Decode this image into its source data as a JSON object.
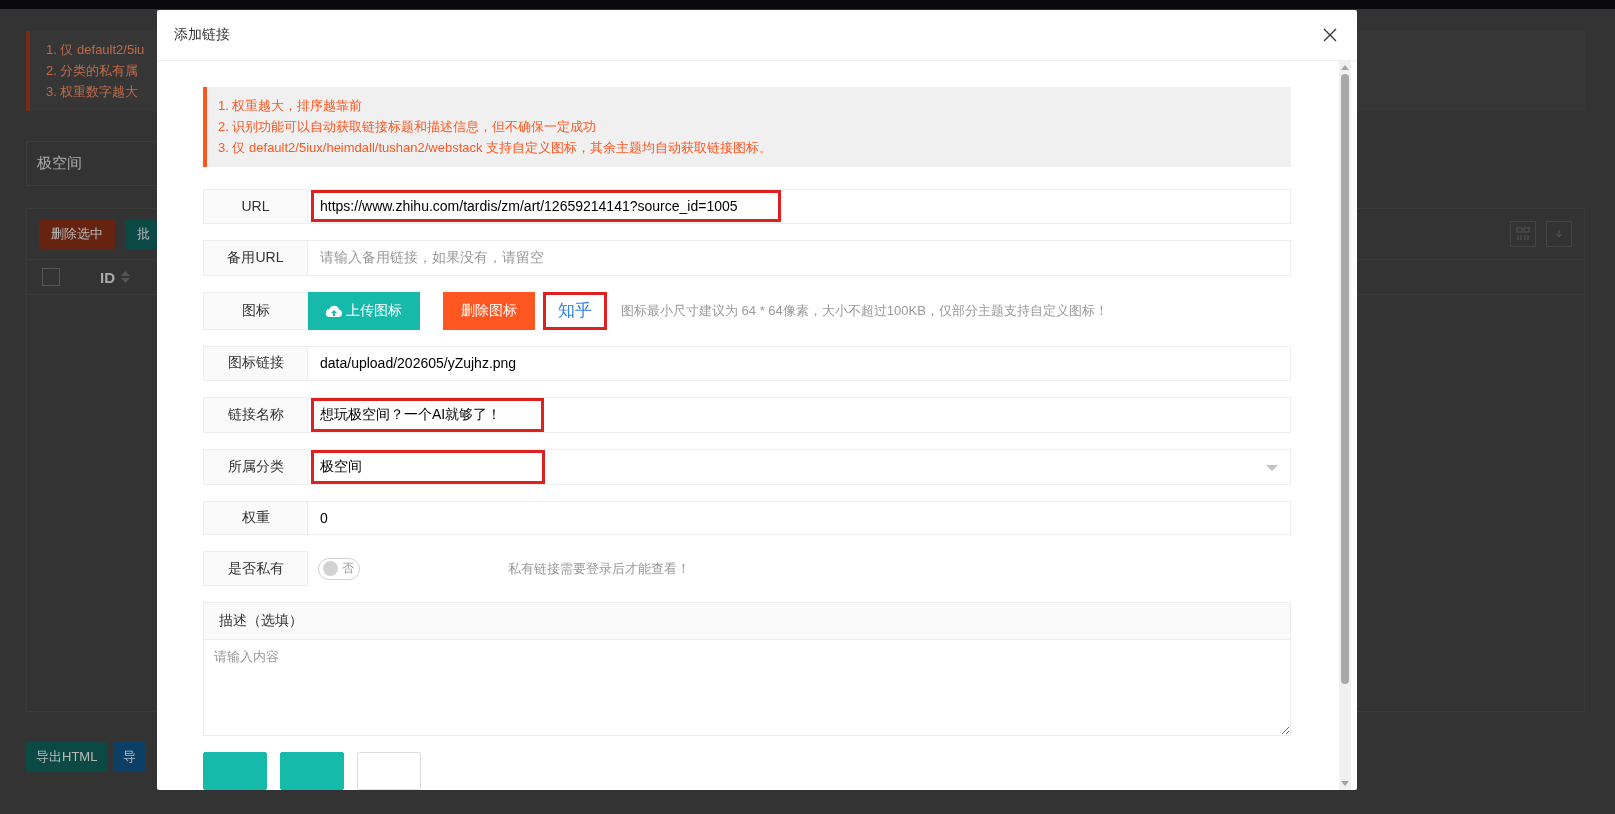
{
  "page": {
    "notices": [
      "1. 仅 default2/5iu",
      "2. 分类的私有属",
      "3. 权重数字越大"
    ],
    "category_filter": "极空间",
    "toolbar_buttons": [
      {
        "label": "删除选中",
        "kind": "danger"
      },
      {
        "label": "批",
        "kind": "primary"
      }
    ],
    "table": {
      "select_all_checked": false,
      "columns": [
        "ID"
      ]
    },
    "footer_buttons": [
      {
        "label": "导出HTML",
        "kind": "primary"
      },
      {
        "label": "导",
        "kind": "info"
      }
    ]
  },
  "dialog": {
    "title": "添加链接",
    "notices": [
      "1. 权重越大，排序越靠前",
      "2. 识别功能可以自动获取链接标题和描述信息，但不确保一定成功",
      "3. 仅 default2/5iux/heimdall/tushan2/webstack 支持自定义图标，其余主题均自动获取链接图标。"
    ],
    "fields": [
      {
        "kind": "text",
        "label": "URL",
        "value": "https://www.zhihu.com/tardis/zm/art/12659214141?source_id=1005",
        "highlighted": true
      },
      {
        "kind": "text",
        "label": "备用URL",
        "placeholder": "请输入备用链接，如果没有，请留空",
        "highlighted": false
      },
      {
        "kind": "icon",
        "label": "图标",
        "buttons": [
          {
            "label": "上传图标",
            "kind": "primary"
          },
          {
            "label": "删除图标",
            "kind": "danger"
          }
        ],
        "preview": "知乎",
        "highlighted": true,
        "hint": "图标最小尺寸建议为 64 * 64像素，大小不超过100KB，仅部分主题支持自定义图标！"
      },
      {
        "kind": "text",
        "label": "图标链接",
        "value": "data/upload/202605/yZujhz.png",
        "highlighted": false
      },
      {
        "kind": "text",
        "label": "链接名称",
        "value": "想玩极空间？一个AI就够了！",
        "highlighted": true
      },
      {
        "kind": "select",
        "label": "所属分类",
        "value": "极空间",
        "highlighted": true
      },
      {
        "kind": "text",
        "label": "权重",
        "value": "0",
        "highlighted": false
      },
      {
        "kind": "switch",
        "label": "是否私有",
        "on": false,
        "switch_text": "否",
        "hint": "私有链接需要登录后才能查看！"
      }
    ],
    "description": {
      "label": "描述（选填）",
      "placeholder": "请输入内容"
    },
    "action_buttons": [
      {
        "kind": "primary"
      },
      {
        "kind": "primary"
      },
      {
        "kind": "plain"
      }
    ]
  }
}
